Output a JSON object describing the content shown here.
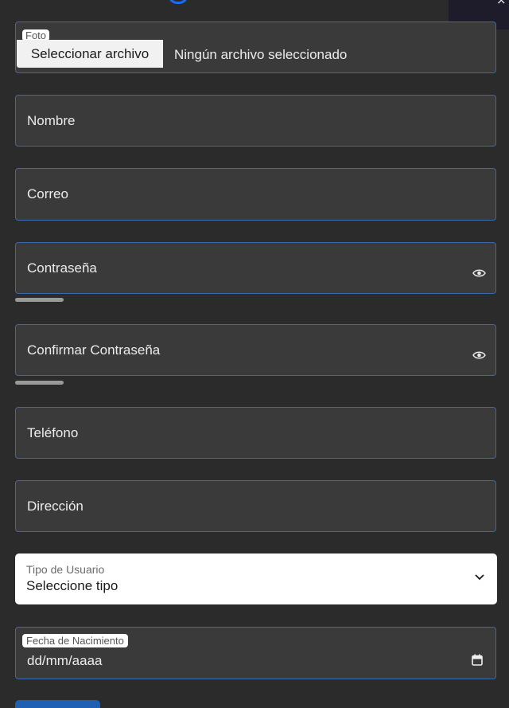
{
  "header": {
    "close_glyph": "×"
  },
  "form": {
    "photo": {
      "label": "Foto",
      "button_label": "Seleccionar archivo",
      "status": "Ningún archivo seleccionado"
    },
    "name": {
      "placeholder": "Nombre"
    },
    "email": {
      "placeholder": "Correo"
    },
    "password": {
      "placeholder": "Contraseña",
      "icon": "eye-icon"
    },
    "confirm_password": {
      "placeholder": "Confirmar Contraseña",
      "icon": "eye-icon"
    },
    "phone": {
      "placeholder": "Teléfono"
    },
    "address": {
      "placeholder": "Dirección"
    },
    "user_type": {
      "label": "Tipo de Usuario",
      "selected": "Seleccione tipo",
      "icon": "chevron-down-icon"
    },
    "birth_date": {
      "label": "Fecha de Nacimiento",
      "value": "dd/mm/aaaa",
      "icon": "calendar-icon"
    }
  },
  "colors": {
    "background": "#2b2b2b",
    "field_bg": "#3a3a3a",
    "field_border": "#3b69ad",
    "accent": "#1a6ef5"
  }
}
